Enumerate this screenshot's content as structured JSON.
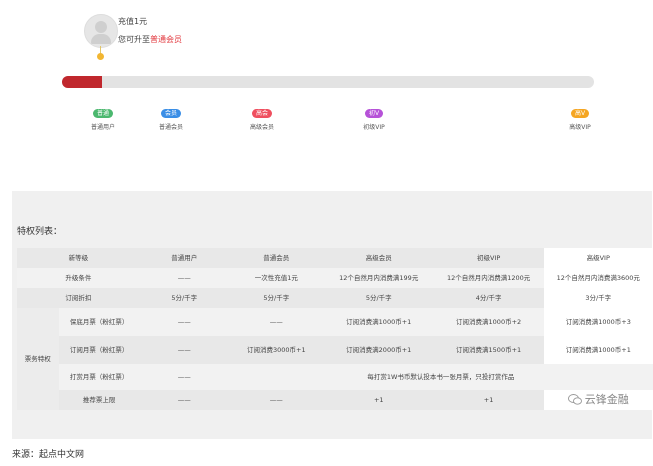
{
  "header": {
    "charge_text": "充值1元",
    "upgrade_prefix": "您可升至",
    "upgrade_target": "普通会员",
    "progress_percent": 7.5
  },
  "levels": [
    {
      "badge": "普通",
      "name": "普通用户",
      "color": "#4cb86f"
    },
    {
      "badge": "会员",
      "name": "普通会员",
      "color": "#3a8ee6"
    },
    {
      "badge": "高会",
      "name": "高级会员",
      "color": "#ef4f5f"
    },
    {
      "badge": "初V",
      "name": "初级VIP",
      "color": "#b652d8"
    },
    {
      "badge": "高V",
      "name": "高级VIP",
      "color": "#f5a623"
    }
  ],
  "section_title": "特权列表：",
  "table": {
    "header": [
      "新等级",
      "普通用户",
      "普通会员",
      "高级会员",
      "初级VIP",
      "高级VIP"
    ],
    "upgrade_row": {
      "label": "升级条件",
      "c1": "——",
      "c2": "一次性充值1元",
      "c3": "12个自然月内消费满199元",
      "c4": "12个自然月内消费满1200元",
      "c5": "12个自然月内消费满3600元"
    },
    "discount_row": {
      "label": "订阅折扣",
      "c1": "5分/千字",
      "c2": "5分/千字",
      "c3": "5分/千字",
      "c4": "4分/千字",
      "c5": "3分/千字"
    },
    "group_label": "票务特权",
    "guarantee_row": {
      "label": "保底月票（粉红票）",
      "c1": "——",
      "c2": "——",
      "c3": "订阅消费满1000币+1",
      "c4": "订阅消费满1000币+2",
      "c5": "订阅消费满1000币+3"
    },
    "subscribe_row": {
      "label": "订阅月票（粉红票）",
      "c1": "——",
      "c2": "订阅消费3000币+1",
      "c3": "订阅消费满2000币+1",
      "c4": "订阅消费满1500币+1",
      "c5": "订阅消费满1000币+1"
    },
    "reward_row": {
      "label": "打赏月票（粉红票）",
      "c1": "——",
      "c_span": "每打赏1W书币默认投本书一张月票，只投打赏作品"
    },
    "recommend_row": {
      "label": "推荐票上限",
      "c1": "——",
      "c2": "——",
      "c3": "+1",
      "c4": "+1"
    }
  },
  "watermark": "云锋金融",
  "source": "来源：起点中文网",
  "colors": {
    "accent_red": "#c0272d",
    "link_red": "#e2383e"
  }
}
